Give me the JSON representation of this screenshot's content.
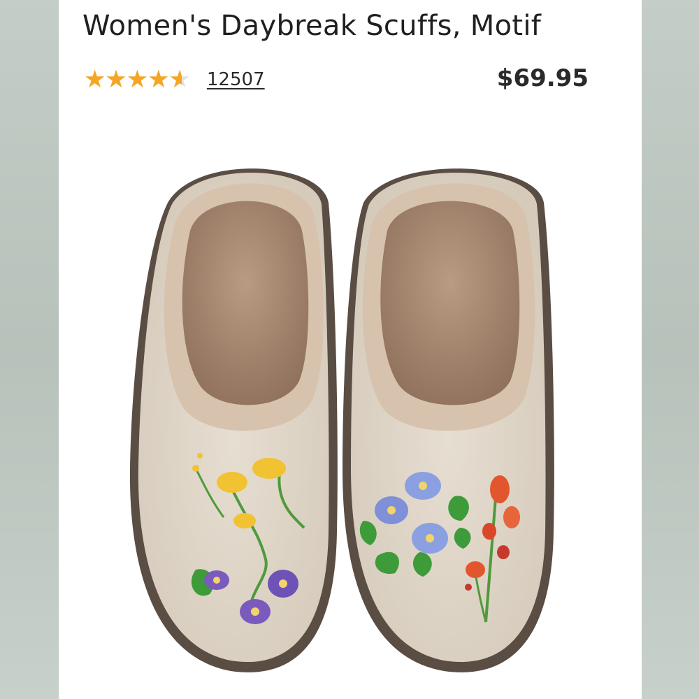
{
  "product": {
    "title": "Women's Daybreak Scuffs, Motif",
    "rating": 4.6,
    "rating_max": 5,
    "review_count": "12507",
    "price": "$69.95",
    "star_color": "#f5a623",
    "image_alt": "Pair of beige wool scuff slippers with fleece lining and embroidered flowers"
  }
}
